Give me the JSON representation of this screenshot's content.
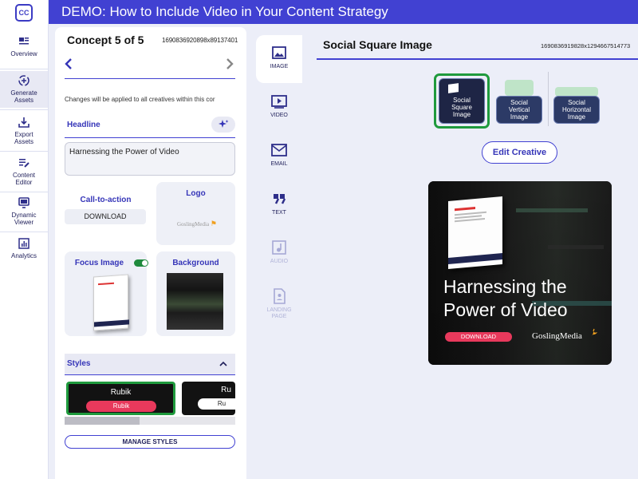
{
  "nav": {
    "logo": "CC",
    "items": [
      {
        "label": "Overview"
      },
      {
        "label": "Generate Assets"
      },
      {
        "label": "Export Assets"
      },
      {
        "label": "Content Editor"
      },
      {
        "label": "Dynamic Viewer"
      },
      {
        "label": "Analytics"
      }
    ]
  },
  "banner": {
    "title": "DEMO: How to Include Video in Your Content Strategy"
  },
  "concept": {
    "title": "Concept 5 of 5",
    "id": "1690836920898x89137401",
    "notice": "Changes will be applied to all creatives within this cor",
    "headline_label": "Headline",
    "headline_value": "Harnessing the Power of Video",
    "cta_label": "Call-to-action",
    "cta_value": "DOWNLOAD",
    "logo_label": "Logo",
    "logo_text": "GoslingMedia",
    "focus_label": "Focus Image",
    "background_label": "Background",
    "styles_label": "Styles",
    "style_cards": [
      {
        "name": "Rubik",
        "button": "Rubik"
      },
      {
        "name": "Ru",
        "button": "Ru"
      }
    ],
    "manage_styles": "MANAGE STYLES"
  },
  "asset_types": [
    {
      "label": "IMAGE",
      "icon": "image-icon"
    },
    {
      "label": "VIDEO",
      "icon": "video-icon"
    },
    {
      "label": "EMAIL",
      "icon": "email-icon"
    },
    {
      "label": "TEXT",
      "icon": "quote-icon"
    },
    {
      "label": "AUDIO",
      "icon": "audio-icon"
    },
    {
      "label": "LANDING PAGE",
      "icon": "page-icon"
    }
  ],
  "preview": {
    "title": "Social Square Image",
    "id": "1690836919828x1294667514773",
    "formats": [
      {
        "label": "Social Square Image",
        "selected": true
      },
      {
        "label": "Social Vertical Image",
        "selected": false
      },
      {
        "label": "Social Horizontal Image",
        "selected": false
      }
    ],
    "edit_button": "Edit Creative",
    "headline": "Harnessing the Power of Video",
    "cta": "DOWNLOAD",
    "brand": "GoslingMedia"
  },
  "colors": {
    "brand": "#4141d2",
    "selected": "#1f9a3d",
    "cta": "#e8395c",
    "format_tile": "#2c3a66"
  }
}
